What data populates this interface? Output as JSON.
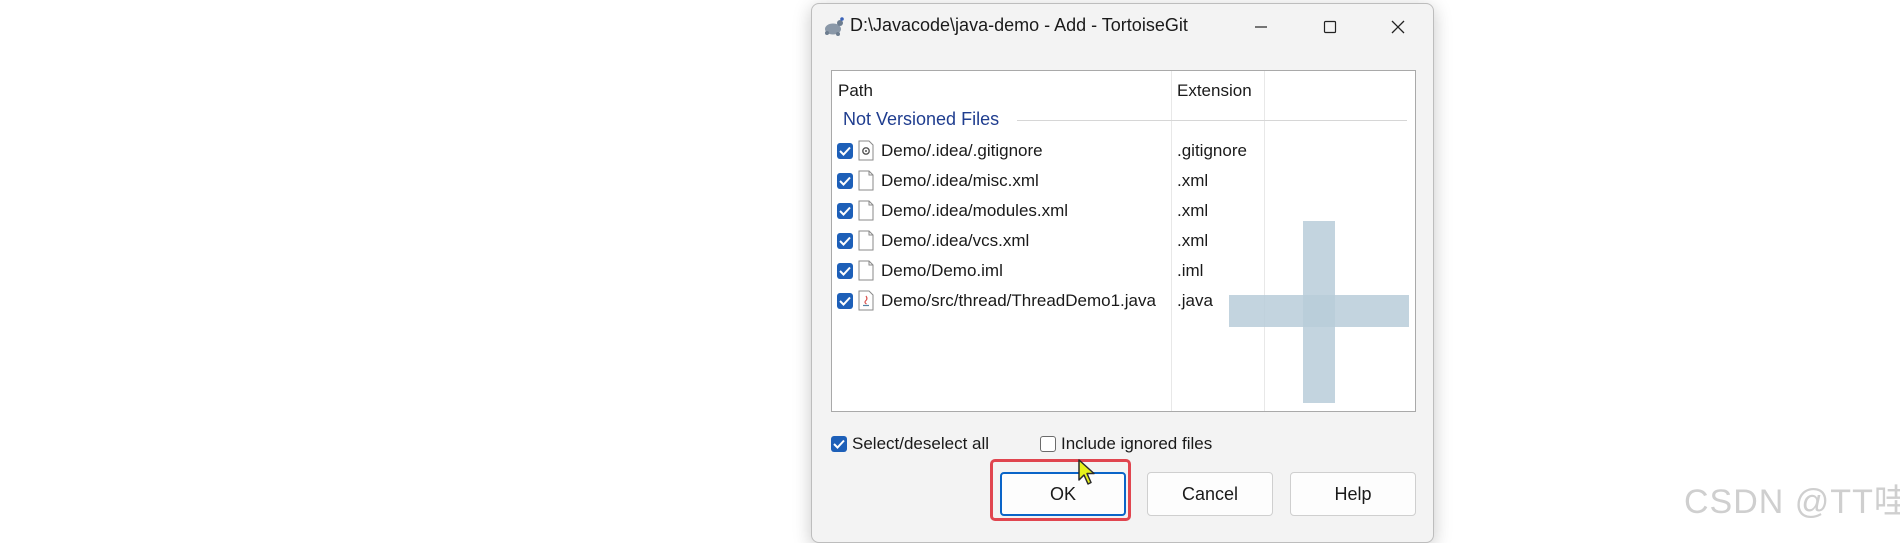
{
  "window": {
    "title": "D:\\Javacode\\java-demo - Add - TortoiseGit",
    "app_icon": "tortoisegit-icon",
    "controls": [
      "minimize-icon",
      "maximize-icon",
      "close-icon"
    ]
  },
  "list": {
    "columns": [
      "Path",
      "Extension"
    ],
    "group": "Not Versioned Files",
    "rows": [
      {
        "path": "Demo/.idea/.gitignore",
        "extension": ".gitignore",
        "icon": "config-file-icon",
        "checked": true
      },
      {
        "path": "Demo/.idea/misc.xml",
        "extension": ".xml",
        "icon": "file-icon",
        "checked": true
      },
      {
        "path": "Demo/.idea/modules.xml",
        "extension": ".xml",
        "icon": "file-icon",
        "checked": true
      },
      {
        "path": "Demo/.idea/vcs.xml",
        "extension": ".xml",
        "icon": "file-icon",
        "checked": true
      },
      {
        "path": "Demo/Demo.iml",
        "extension": ".iml",
        "icon": "file-icon",
        "checked": true
      },
      {
        "path": "Demo/src/thread/ThreadDemo1.java",
        "extension": ".java",
        "icon": "java-file-icon",
        "checked": true
      }
    ]
  },
  "options": {
    "select_all": {
      "label": "Select/deselect all",
      "checked": true
    },
    "include_ignored": {
      "label": "Include ignored files",
      "checked": false
    }
  },
  "buttons": {
    "ok": "OK",
    "cancel": "Cancel",
    "help": "Help"
  },
  "watermark": "CSDN @TT哇",
  "colors": {
    "accent": "#1d5fb8",
    "group_text": "#1f3d8f",
    "highlight": "#e0454f",
    "overlay": "#b9cdd9"
  }
}
